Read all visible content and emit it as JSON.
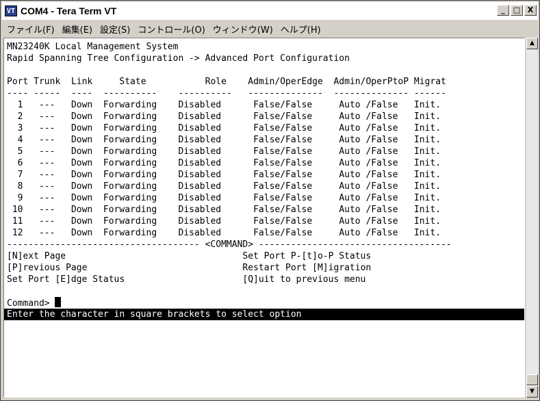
{
  "window": {
    "title": "COM4 - Tera Term VT",
    "app_icon": "terminal-icon",
    "controls": {
      "minimize": "_",
      "maximize": "□",
      "close": "X"
    }
  },
  "menubar": {
    "items": [
      "ファイル(F)",
      "編集(E)",
      "設定(S)",
      "コントロール(O)",
      "ウィンドウ(W)",
      "ヘルプ(H)"
    ]
  },
  "terminal": {
    "header_line1": "MN23240K Local Management System",
    "header_line2": "Rapid Spanning Tree Configuration -> Advanced Port Configuration",
    "columns": [
      "Port",
      "Trunk",
      "Link",
      "State",
      "Role",
      "Admin/OperEdge",
      "Admin/OperPtoP",
      "Migrat"
    ],
    "rows": [
      [
        "1",
        "---",
        "Down",
        "Forwarding",
        "Disabled",
        "False/False",
        "Auto /False",
        "Init."
      ],
      [
        "2",
        "---",
        "Down",
        "Forwarding",
        "Disabled",
        "False/False",
        "Auto /False",
        "Init."
      ],
      [
        "3",
        "---",
        "Down",
        "Forwarding",
        "Disabled",
        "False/False",
        "Auto /False",
        "Init."
      ],
      [
        "4",
        "---",
        "Down",
        "Forwarding",
        "Disabled",
        "False/False",
        "Auto /False",
        "Init."
      ],
      [
        "5",
        "---",
        "Down",
        "Forwarding",
        "Disabled",
        "False/False",
        "Auto /False",
        "Init."
      ],
      [
        "6",
        "---",
        "Down",
        "Forwarding",
        "Disabled",
        "False/False",
        "Auto /False",
        "Init."
      ],
      [
        "7",
        "---",
        "Down",
        "Forwarding",
        "Disabled",
        "False/False",
        "Auto /False",
        "Init."
      ],
      [
        "8",
        "---",
        "Down",
        "Forwarding",
        "Disabled",
        "False/False",
        "Auto /False",
        "Init."
      ],
      [
        "9",
        "---",
        "Down",
        "Forwarding",
        "Disabled",
        "False/False",
        "Auto /False",
        "Init."
      ],
      [
        "10",
        "---",
        "Down",
        "Forwarding",
        "Disabled",
        "False/False",
        "Auto /False",
        "Init."
      ],
      [
        "11",
        "---",
        "Down",
        "Forwarding",
        "Disabled",
        "False/False",
        "Auto /False",
        "Init."
      ],
      [
        "12",
        "---",
        "Down",
        "Forwarding",
        "Disabled",
        "False/False",
        "Auto /False",
        "Init."
      ]
    ],
    "command_label": "<COMMAND>",
    "commands_left": [
      "[N]ext Page",
      "[P]revious Page",
      "Set Port [E]dge Status"
    ],
    "commands_right": [
      "Set Port P-[t]o-P Status",
      "Restart Port [M]igration",
      "[Q]uit to previous menu"
    ],
    "prompt": "Command>",
    "status_bar": "Enter the character in square brackets to select option"
  },
  "scrollbar": {
    "up_icon": "▲",
    "down_icon": "▼"
  }
}
